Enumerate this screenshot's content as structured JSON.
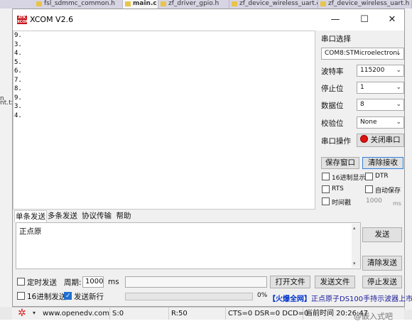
{
  "background": {
    "tabs": [
      {
        "label": "fsl_sdmmc_common.h",
        "active": false
      },
      {
        "label": "main.c",
        "active": true
      },
      {
        "label": "zf_driver_gpio.h",
        "active": false
      },
      {
        "label": "zf_device_wireless_uart.c",
        "active": false
      },
      {
        "label": "zf_device_wireless_uart.h",
        "active": false
      }
    ],
    "left_fragments": [
      "n",
      "nt.txt"
    ]
  },
  "window": {
    "title": "XCOM V2.6",
    "logo_text": "ATK XCOM",
    "min_icon": "—",
    "max_icon": "☐",
    "close_icon": "✕"
  },
  "receive": {
    "lines": [
      "9.",
      "3.",
      "4.",
      "5.",
      "6.",
      "7.",
      "8.",
      "9.",
      "3.",
      "4."
    ]
  },
  "panel": {
    "port_label": "串口选择",
    "port_value": "COM8:STMicroelectroni",
    "baud_label": "波特率",
    "baud_value": "115200",
    "stop_label": "停止位",
    "stop_value": "1",
    "data_label": "数据位",
    "data_value": "8",
    "parity_label": "校验位",
    "parity_value": "None",
    "op_label": "串口操作",
    "op_button": "关闭串口",
    "save_window": "保存窗口",
    "clear_recv": "清除接收",
    "hex_display": "16进制显示",
    "dtr": "DTR",
    "rts": "RTS",
    "auto_save": "自动保存",
    "timestamp": "时间戳",
    "timestamp_value": "1000",
    "timestamp_unit": "ms"
  },
  "tabs": [
    "单条发送",
    "多条发送",
    "协议传输",
    "帮助"
  ],
  "send": {
    "text": "正点原",
    "send_button": "发送",
    "clear_send": "清除发送"
  },
  "bottom": {
    "timed_send": "定时发送",
    "period_label": "周期:",
    "period_value": "1000",
    "period_unit": "ms",
    "open_file": "打开文件",
    "send_file": "发送文件",
    "stop_send": "停止发送",
    "hex_send": "16进制发送",
    "send_newline": "发送新行",
    "progress_text": "0%",
    "progress": 0,
    "promo": "【火爆全网】正点原子DS100手持示波器上市",
    "promo_bracket": "【火爆全网】",
    "promo_rest": "正点原子DS100手持示波器上市"
  },
  "status": {
    "url": "www.openedv.com",
    "s": "S:0",
    "r": "R:50",
    "lines": "CTS=0 DSR=0 DCD=0",
    "time": "当前时间 20:26:47"
  },
  "watermark": "@嵌入式吧",
  "colors": {
    "accent": "#1f6fd1",
    "logo": "#c6161c",
    "promo": "#1a1a9c"
  }
}
